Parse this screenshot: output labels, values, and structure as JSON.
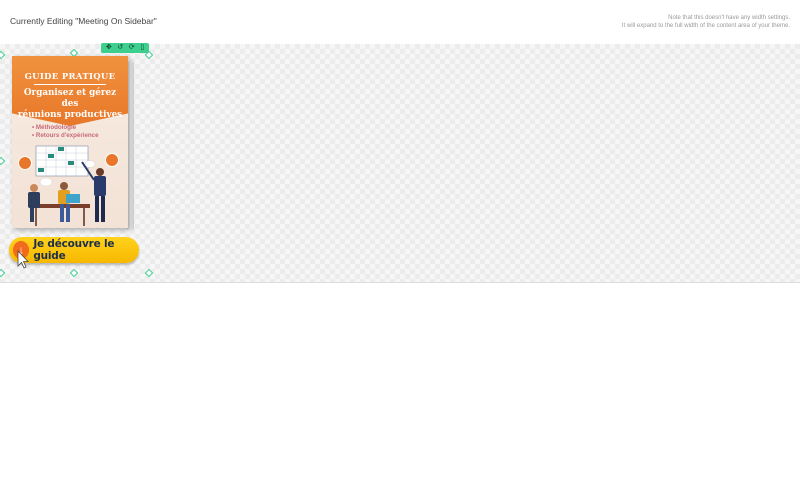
{
  "header": {
    "editing_title": "Currently Editing \"Meeting On Sidebar\"",
    "note_line1": "Note that this doesn't have any width settings.",
    "note_line2": "It will expand to the full width of the content area of your theme."
  },
  "toolbar": {
    "items": [
      {
        "icon": "move-icon",
        "glyph": "✥"
      },
      {
        "icon": "undo-icon",
        "glyph": "↺"
      },
      {
        "icon": "refresh-icon",
        "glyph": "⟳"
      },
      {
        "icon": "delete-icon",
        "glyph": "▯"
      }
    ]
  },
  "book": {
    "label": "GUIDE PRATIQUE",
    "title_line1": "Organisez et gérez des",
    "title_line2": "réunions productives",
    "bullet1": "• Méthodologie",
    "bullet2": "• Retours d'expérience"
  },
  "cta": {
    "label": "Je découvre le guide",
    "icon": "download-arrow-icon"
  },
  "colors": {
    "accent_green": "#3ecf8e",
    "cover_orange": "#e8772a",
    "cta_yellow": "#ffd21c",
    "cta_text": "#1c2f4a"
  }
}
